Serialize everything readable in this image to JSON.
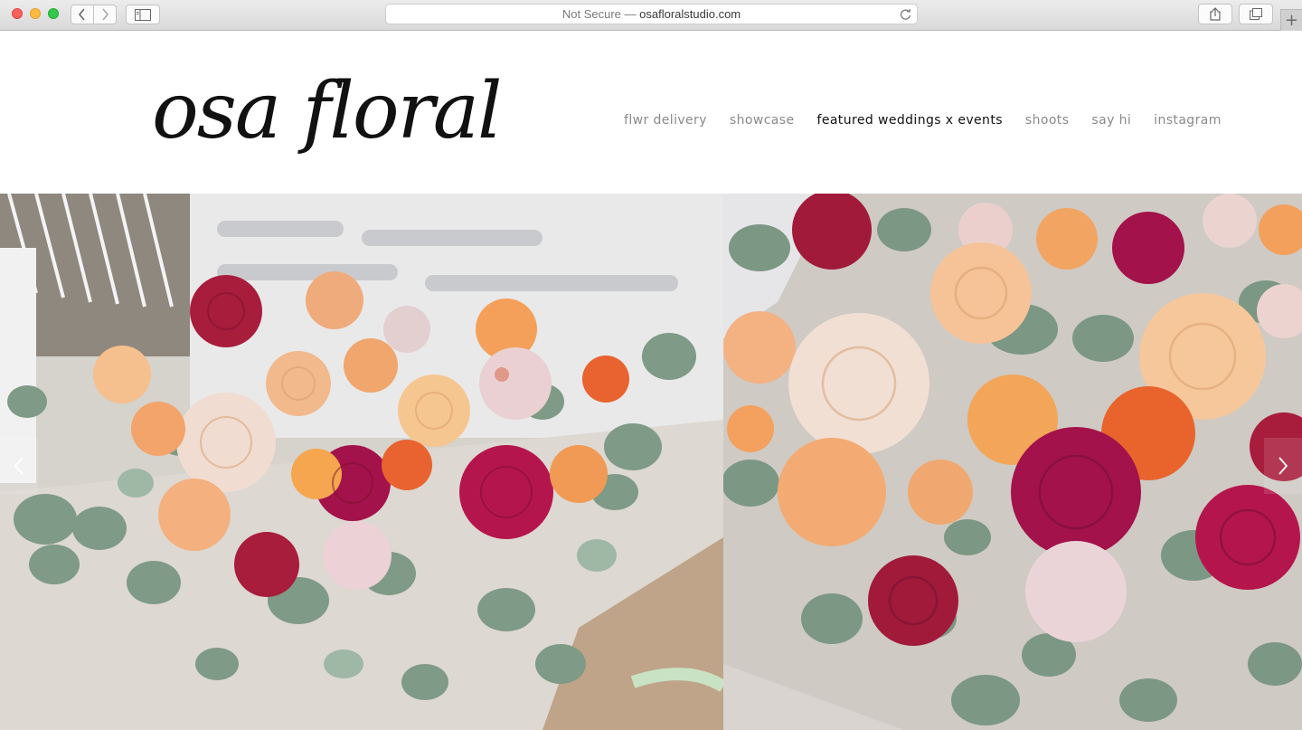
{
  "browser": {
    "address_prefix": "Not Secure — ",
    "address_host": "osafloralstudio.com",
    "icons": [
      "back-chevron-icon",
      "forward-chevron-icon",
      "sidebar-icon",
      "reload-icon",
      "share-icon",
      "tabs-icon",
      "plus-icon"
    ],
    "new_tab": "+"
  },
  "site": {
    "logo_text": "osa floral",
    "nav": [
      {
        "label": "flwr delivery",
        "active": false
      },
      {
        "label": "showcase",
        "active": false
      },
      {
        "label": "featured weddings x events",
        "active": true
      },
      {
        "label": "shoots",
        "active": false
      },
      {
        "label": "say hi",
        "active": false
      },
      {
        "label": "instagram",
        "active": false
      }
    ]
  },
  "gallery": {
    "slides": [
      "floral-arrangement-photo-1",
      "floral-arrangement-photo-2"
    ],
    "prev_icon": "chevron-left-icon",
    "next_icon": "chevron-right-icon"
  },
  "colors": {
    "accent_text": "#111111",
    "nav_text": "#8a8a8a",
    "rose_magenta": "#a3124a",
    "rose_peach": "#f2b98c",
    "rose_orange": "#e8632f",
    "rose_blush": "#e7cfc6",
    "eucalyptus": "#7f9a86"
  }
}
